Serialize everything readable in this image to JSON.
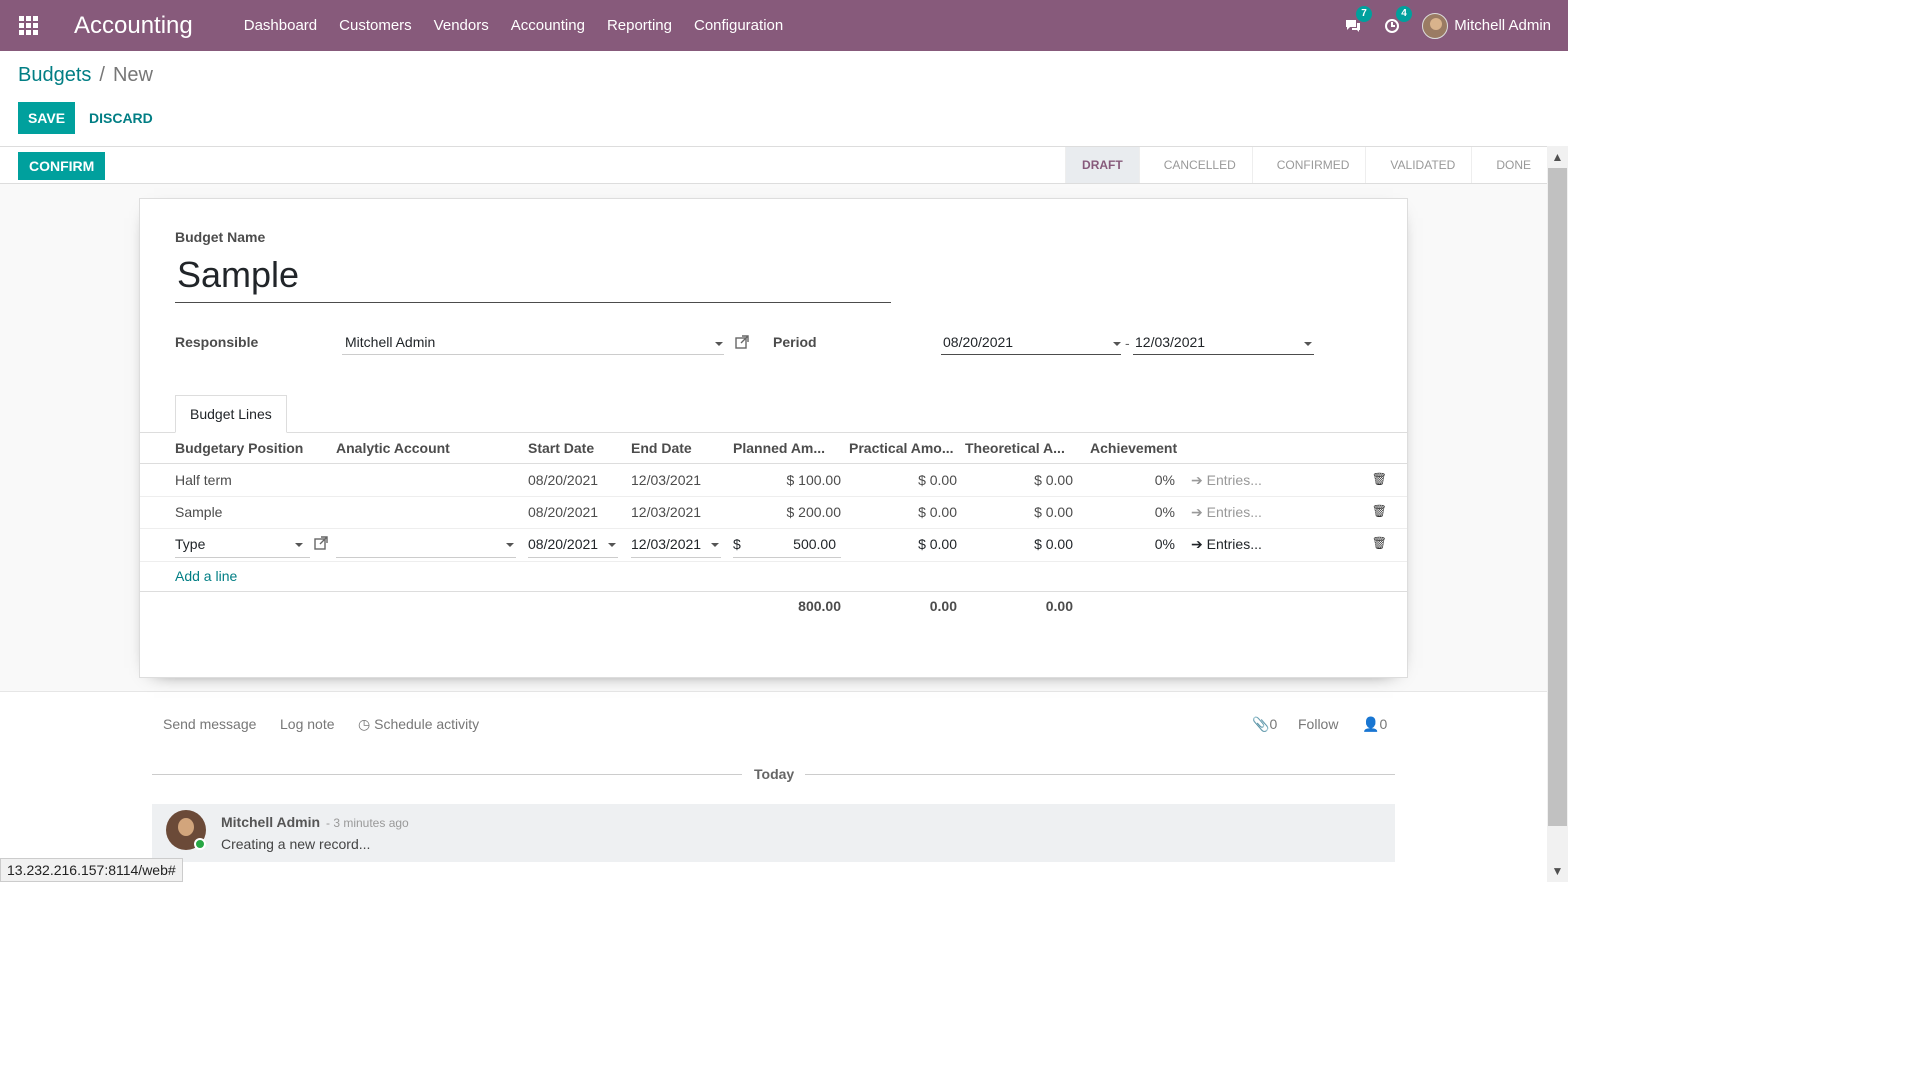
{
  "navbar": {
    "app_title": "Accounting",
    "menu": [
      "Dashboard",
      "Customers",
      "Vendors",
      "Accounting",
      "Reporting",
      "Configuration"
    ],
    "messages_count": "7",
    "activities_count": "4",
    "user_name": "Mitchell Admin",
    "color": "#875a7b"
  },
  "breadcrumb": {
    "parent": "Budgets",
    "separator": "/",
    "current": "New"
  },
  "buttons": {
    "save": "SAVE",
    "discard": "DISCARD",
    "confirm": "CONFIRM"
  },
  "stages": [
    "DRAFT",
    "CANCELLED",
    "CONFIRMED",
    "VALIDATED",
    "DONE"
  ],
  "active_stage": "DRAFT",
  "form": {
    "budget_name_label": "Budget Name",
    "budget_name": "Sample",
    "responsible_label": "Responsible",
    "responsible": "Mitchell Admin",
    "period_label": "Period",
    "period_start": "08/20/2021",
    "period_sep": "-",
    "period_end": "12/03/2021"
  },
  "tab": "Budget Lines",
  "columns": [
    "Budgetary Position",
    "Analytic Account",
    "Start Date",
    "End Date",
    "Planned Am...",
    "Practical Amo...",
    "Theoretical A...",
    "Achievement"
  ],
  "rows": [
    {
      "position": "Half term",
      "start": "08/20/2021",
      "end": "12/03/2021",
      "planned": "$ 100.00",
      "practical": "$ 0.00",
      "theoretical": "$ 0.00",
      "achievement": "0%",
      "entries": "Entries..."
    },
    {
      "position": "Sample",
      "start": "08/20/2021",
      "end": "12/03/2021",
      "planned": "$ 200.00",
      "practical": "$ 0.00",
      "theoretical": "$ 0.00",
      "achievement": "0%",
      "entries": "Entries..."
    },
    {
      "position": "Type",
      "start": "08/20/2021",
      "end": "12/03/2021",
      "currency": "$",
      "planned": "500.00",
      "practical": "$ 0.00",
      "theoretical": "$ 0.00",
      "achievement": "0%",
      "entries": "Entries..."
    }
  ],
  "add_line": "Add a line",
  "totals": {
    "planned": "800.00",
    "practical": "0.00",
    "theoretical": "0.00"
  },
  "chatter": {
    "send_message": "Send message",
    "log_note": "Log note",
    "schedule_activity": "Schedule activity",
    "attachments": "0",
    "follow": "Follow",
    "followers": "0",
    "today": "Today",
    "message": {
      "author": "Mitchell Admin",
      "date": "- 3 minutes ago",
      "body": "Creating a new record..."
    }
  },
  "status_url": "13.232.216.157:8114/web#"
}
